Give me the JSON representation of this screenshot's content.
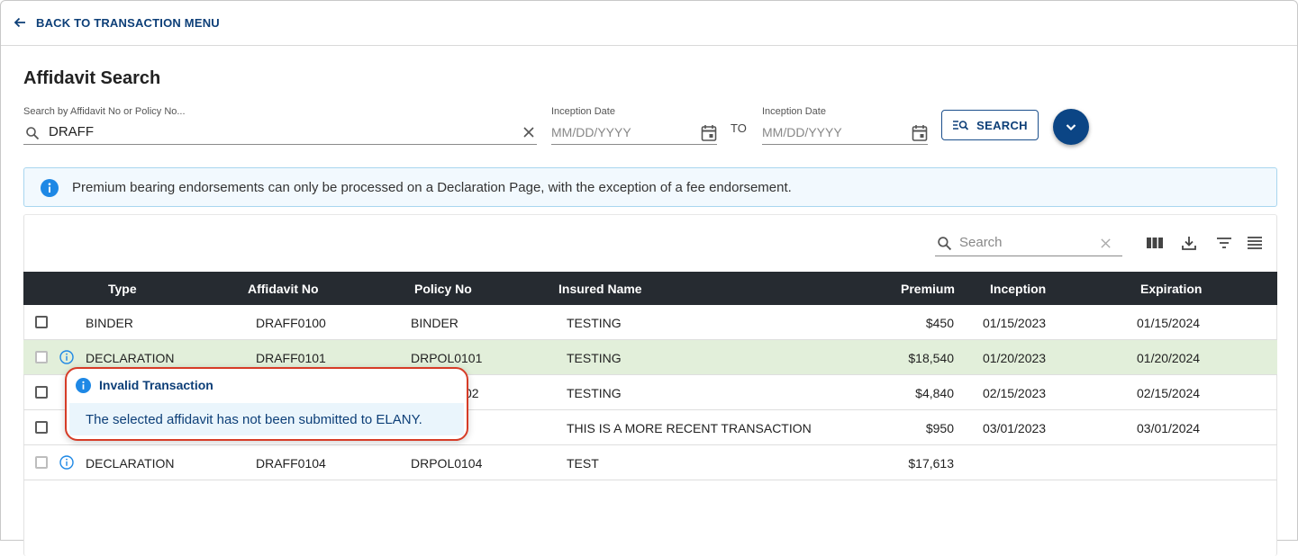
{
  "nav": {
    "back_label": "BACK TO TRANSACTION MENU"
  },
  "page": {
    "title": "Affidavit Search"
  },
  "search": {
    "label": "Search by Affidavit No or Policy No...",
    "value": "DRAFF",
    "date_from_label": "Inception Date",
    "date_from_placeholder": "MM/DD/YYYY",
    "to_label": "TO",
    "date_to_label": "Inception Date",
    "date_to_placeholder": "MM/DD/YYYY",
    "button_label": "SEARCH"
  },
  "banner": {
    "message": "Premium bearing endorsements can only be processed on a Declaration Page, with the exception of a fee endorsement."
  },
  "table": {
    "search_placeholder": "Search",
    "columns": [
      "Type",
      "Affidavit No",
      "Policy No",
      "Insured Name",
      "Premium",
      "Inception",
      "Expiration"
    ],
    "rows": [
      {
        "type": "BINDER",
        "affidavit_no": "DRAFF0100",
        "policy_no": "BINDER",
        "insured_name": "TESTING",
        "premium": "$450",
        "inception": "01/15/2023",
        "expiration": "01/15/2024"
      },
      {
        "type": "DECLARATION",
        "affidavit_no": "DRAFF0101",
        "policy_no": "DRPOL0101",
        "insured_name": "TESTING",
        "premium": "$18,540",
        "inception": "01/20/2023",
        "expiration": "01/20/2024"
      },
      {
        "type": "",
        "affidavit_no": "",
        "policy_no": "02",
        "insured_name": "TESTING",
        "premium": "$4,840",
        "inception": "02/15/2023",
        "expiration": "02/15/2024"
      },
      {
        "type": "",
        "affidavit_no": "",
        "policy_no": "",
        "insured_name": "THIS IS A MORE RECENT TRANSACTION",
        "premium": "$950",
        "inception": "03/01/2023",
        "expiration": "03/01/2024"
      },
      {
        "type": "DECLARATION",
        "affidavit_no": "DRAFF0104",
        "policy_no": "DRPOL0104",
        "insured_name": "TEST",
        "premium": "$17,613",
        "inception": "",
        "expiration": ""
      }
    ]
  },
  "popover": {
    "title": "Invalid Transaction",
    "message": "The selected affidavit has not been submitted to ELANY."
  },
  "colors": {
    "brand": "#0d3f78",
    "header_bg": "#262b31",
    "highlight_row": "#e2efda",
    "popover_border": "#d63c27",
    "info_blue": "#1e88e5"
  }
}
